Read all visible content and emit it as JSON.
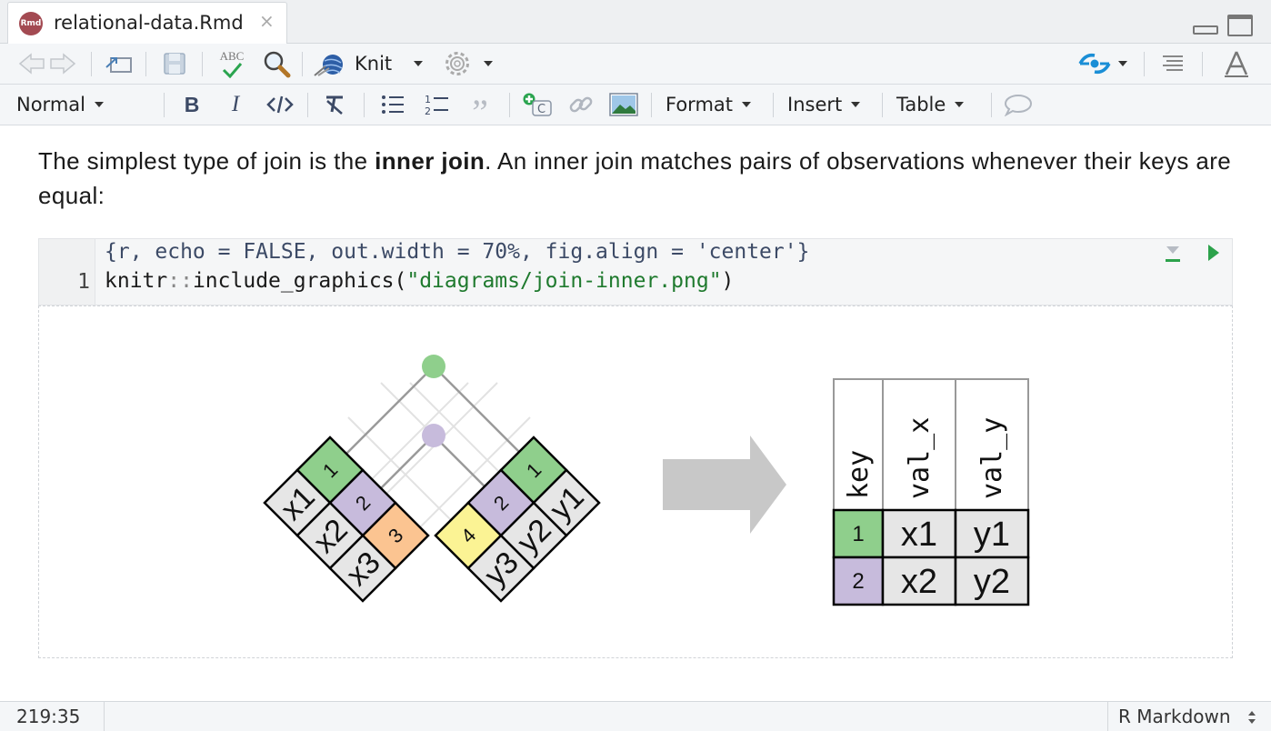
{
  "tab": {
    "title": "relational-data.Rmd",
    "icon_text": "Rmd",
    "close": "×"
  },
  "toolbar": {
    "knit_label": "Knit"
  },
  "format_bar": {
    "paragraph_style": "Normal",
    "format_menu": "Format",
    "insert_menu": "Insert",
    "table_menu": "Table",
    "spell_text": "ABC"
  },
  "content": {
    "para_before": "The simplest type of join is the ",
    "para_bold": "inner join",
    "para_after": ". An inner join matches pairs of observations whenever their keys are equal:"
  },
  "chunk": {
    "header": "{r, echo = FALSE, out.width = 70%, fig.align = 'center'}",
    "line_number": "1",
    "code_ns": "knitr",
    "code_op": "::",
    "code_fn": "include_graphics(",
    "code_str": "\"diagrams/join-inner.png\"",
    "code_close": ")"
  },
  "diagram": {
    "left_keys": [
      "1",
      "2",
      "3"
    ],
    "left_vals": [
      "x1",
      "x2",
      "x3"
    ],
    "right_keys": [
      "1",
      "2",
      "4"
    ],
    "right_vals": [
      "y1",
      "y2",
      "y3"
    ],
    "result_headers": [
      "key",
      "val_x",
      "val_y"
    ],
    "result_rows": [
      [
        "1",
        "x1",
        "y1"
      ],
      [
        "2",
        "x2",
        "y2"
      ]
    ],
    "colors": {
      "key1": "#8fcf8c",
      "key2": "#c7bbdc",
      "key3": "#fbc491",
      "key4": "#fbf394",
      "cell": "#e6e6e6",
      "arrow": "#c8c8c8"
    }
  },
  "statusbar": {
    "position": "219:35",
    "mode": "R Markdown"
  }
}
